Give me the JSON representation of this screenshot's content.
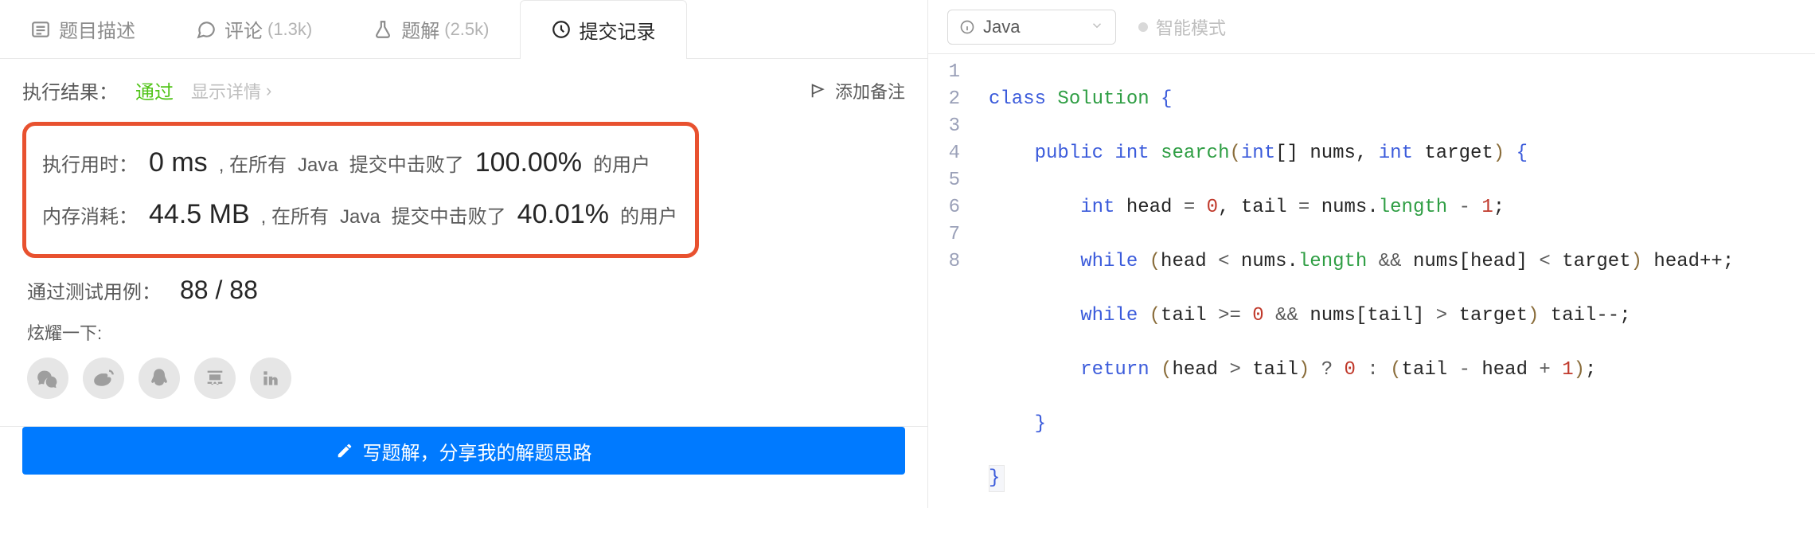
{
  "tabs": {
    "desc": {
      "label": "题目描述"
    },
    "comments": {
      "label": "评论",
      "count": "(1.3k)"
    },
    "solutions": {
      "label": "题解",
      "count": "(2.5k)"
    },
    "records": {
      "label": "提交记录"
    }
  },
  "result": {
    "label": "执行结果：",
    "status": "通过",
    "show_detail": "显示详情",
    "add_note": "添加备注"
  },
  "stats": {
    "runtime": {
      "label": "执行用时：",
      "value": "0 ms",
      "sep": ", 在所有",
      "lang": "Java",
      "beat_pre": "提交中击败了",
      "pct": "100.00%",
      "beat_suf": "的用户"
    },
    "memory": {
      "label": "内存消耗：",
      "value": "44.5 MB",
      "sep": ", 在所有",
      "lang": "Java",
      "beat_pre": "提交中击败了",
      "pct": "40.01%",
      "beat_suf": "的用户"
    }
  },
  "testcases": {
    "label": "通过测试用例：",
    "value": "88 / 88"
  },
  "share": {
    "label": "炫耀一下:",
    "icons": [
      "wechat-icon",
      "weibo-icon",
      "qq-icon",
      "douban-icon",
      "linkedin-icon"
    ]
  },
  "cta": {
    "label": "写题解，分享我的解题思路"
  },
  "editor": {
    "language": "Java",
    "mode": "智能模式",
    "lines": [
      "1",
      "2",
      "3",
      "4",
      "5",
      "6",
      "7",
      "8"
    ]
  },
  "code": {
    "l1": {
      "cls": "class",
      "name": "Solution",
      "brace": "{"
    },
    "l2": {
      "pub": "public",
      "ret": "int",
      "fn": "search",
      "open": "(",
      "t1": "int",
      "arr": "[]",
      "p1": "nums",
      "comma": ",",
      "t2": "int",
      "p2": "target",
      "close": ")",
      "brace": "{"
    },
    "l3": {
      "t": "int",
      "a": "head",
      "eq1": "=",
      "z": "0",
      "c": ",",
      "b": "tail",
      "eq2": "=",
      "n": "nums",
      "dot": ".",
      "len": "length",
      "m": "-",
      "one": "1",
      "semi": ";"
    },
    "l4": {
      "w": "while",
      "o": "(",
      "a": "head",
      "lt": "<",
      "n": "nums",
      "dot": ".",
      "len": "length",
      "and": "&&",
      "n2": "nums",
      "lb": "[",
      "idx": "head",
      "rb": "]",
      "lt2": "<",
      "t": "target",
      "c": ")",
      "stmt": "head++",
      "semi": ";"
    },
    "l5": {
      "w": "while",
      "o": "(",
      "b": "tail",
      "ge": ">=",
      "z": "0",
      "and": "&&",
      "n": "nums",
      "lb": "[",
      "idx": "tail",
      "rb": "]",
      "gt": ">",
      "t": "target",
      "c": ")",
      "stmt": "tail--",
      "semi": ";"
    },
    "l6": {
      "r": "return",
      "o": "(",
      "a": "head",
      "gt": ">",
      "b": "tail",
      "c": ")",
      "q": "?",
      "z": "0",
      "col": ":",
      "o2": "(",
      "b2": "tail",
      "m": "-",
      "a2": "head",
      "p": "+",
      "one": "1",
      "c2": ")",
      "semi": ";"
    },
    "l7": {
      "brace": "}"
    },
    "l8": {
      "brace": "}"
    }
  }
}
